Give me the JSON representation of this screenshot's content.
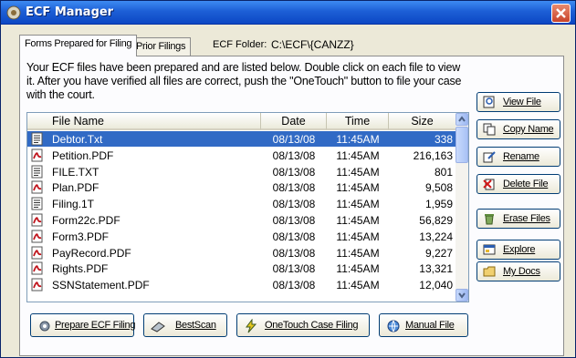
{
  "window": {
    "title": "ECF Manager"
  },
  "tabs": [
    {
      "label": "Forms Prepared for Filing"
    },
    {
      "label": "Prior Filings"
    }
  ],
  "folder": {
    "label": "ECF Folder:",
    "path": "C:\\ECF\\{CANZZ}"
  },
  "instructions": "Your ECF files have been prepared and are listed below. Double click on each file to view it. After you have verified all files are correct, push the \"OneTouch\" button to file your case with the court.",
  "columns": {
    "name": "File Name",
    "date": "Date",
    "time": "Time",
    "size": "Size"
  },
  "files": [
    {
      "name": "Debtor.Txt",
      "date": "08/13/08",
      "time": "11:45AM",
      "size": "338",
      "icon": "text-file-icon"
    },
    {
      "name": "Petition.PDF",
      "date": "08/13/08",
      "time": "11:45AM",
      "size": "216,163",
      "icon": "pdf-file-icon"
    },
    {
      "name": "FILE.TXT",
      "date": "08/13/08",
      "time": "11:45AM",
      "size": "801",
      "icon": "text-file-icon"
    },
    {
      "name": "Plan.PDF",
      "date": "08/13/08",
      "time": "11:45AM",
      "size": "9,508",
      "icon": "pdf-file-icon"
    },
    {
      "name": "Filing.1T",
      "date": "08/13/08",
      "time": "11:45AM",
      "size": "1,959",
      "icon": "text-file-icon"
    },
    {
      "name": "Form22c.PDF",
      "date": "08/13/08",
      "time": "11:45AM",
      "size": "56,829",
      "icon": "pdf-file-icon"
    },
    {
      "name": "Form3.PDF",
      "date": "08/13/08",
      "time": "11:45AM",
      "size": "13,224",
      "icon": "pdf-file-icon"
    },
    {
      "name": "PayRecord.PDF",
      "date": "08/13/08",
      "time": "11:45AM",
      "size": "9,227",
      "icon": "pdf-file-icon"
    },
    {
      "name": "Rights.PDF",
      "date": "08/13/08",
      "time": "11:45AM",
      "size": "13,321",
      "icon": "pdf-file-icon"
    },
    {
      "name": "SSNStatement.PDF",
      "date": "08/13/08",
      "time": "11:45AM",
      "size": "12,040",
      "icon": "pdf-file-icon"
    }
  ],
  "side_buttons": {
    "view_file": "View File",
    "copy_name": "Copy Name",
    "rename": "Rename",
    "delete_file": "Delete File",
    "erase_files": "Erase Files",
    "explore": "Explore",
    "my_docs": "My Docs"
  },
  "bottom_buttons": {
    "prepare": "Prepare ECF Filing",
    "bestscan": "BestScan",
    "onetouch": "OneTouch Case Filing",
    "manual": "Manual File"
  },
  "colors": {
    "titlebar": "#1d5fd6",
    "selection": "#316ac5",
    "pdf_red": "#c0141c"
  }
}
